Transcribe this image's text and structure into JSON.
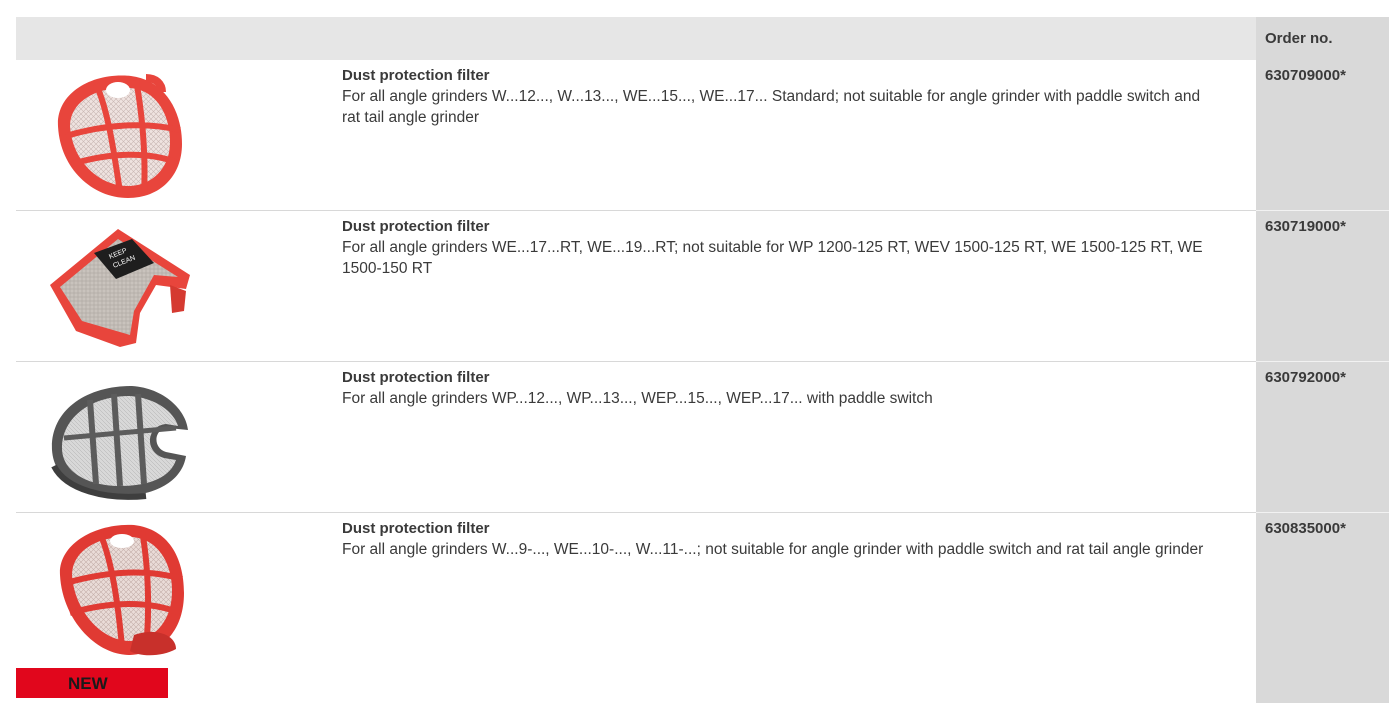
{
  "table": {
    "order_header": "Order no.",
    "rows": [
      {
        "title": "Dust protection filter",
        "description": "For all angle grinders W...12..., W...13..., WE...15..., WE...17... Standard; not suitable for angle grinder with paddle switch and rat tail angle grinder",
        "order_no": "630709000*",
        "image": "red-mesh-dust-filter-cap"
      },
      {
        "title": "Dust protection filter",
        "description": "For all angle grinders WE...17...RT, WE...19...RT; not suitable for WP 1200-125 RT, WEV 1500-125 RT, WE 1500-125 RT, WE 1500-150 RT",
        "order_no": "630719000*",
        "image": "red-gray-dust-filter-keep-clean",
        "image_label": "KEEP CLEAN"
      },
      {
        "title": "Dust protection filter",
        "description": "For all angle grinders WP...12..., WP...13..., WEP...15..., WEP...17... with paddle switch",
        "order_no": "630792000*",
        "image": "gray-mesh-dust-filter"
      },
      {
        "title": "Dust protection filter",
        "description": "For all angle grinders W...9-..., WE...10-..., W...11-...; not suitable for angle grinder with paddle switch and rat tail angle grinder",
        "order_no": "630835000*",
        "image": "red-mesh-dust-filter-new"
      }
    ]
  },
  "badge": {
    "label": "NEW",
    "color": "#e1061c"
  },
  "colors": {
    "header_bg": "#e6e6e6",
    "order_column_bg": "#d9d9d9",
    "filter_red": "#e8453c",
    "filter_gray": "#5a5a5a"
  }
}
